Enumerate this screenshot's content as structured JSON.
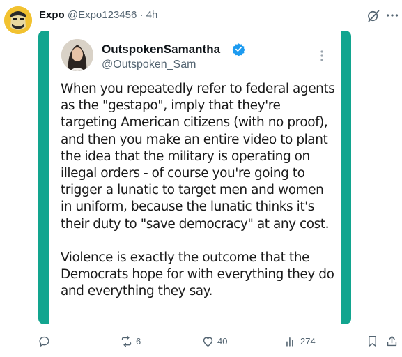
{
  "post": {
    "author_name": "Expo",
    "author_handle": "@Expo123456",
    "separator": "·",
    "time": "4h",
    "icons": {
      "avatar": "cartoon-face-avatar",
      "grok": "grok-icon",
      "more": "more-horizontal-icon"
    }
  },
  "screenshot_card": {
    "border_color": "#12a58f",
    "author_name": "OutspokenSamantha",
    "author_handle": "@Outspoken_Sam",
    "verified": true,
    "verified_color": "#1d9bf0",
    "paragraphs": [
      "When you repeatedly refer to federal agents as the \"gestapo\", imply that they're targeting American citizens (with no proof), and then you make an entire video to plant the idea that the military is operating on illegal orders - of course you're going to trigger a lunatic to target men and women in uniform, because the lunatic thinks it's their duty to \"save democracy\" at any cost.",
      "Violence is exactly the outcome that the Democrats hope for with everything they do and everything they say."
    ]
  },
  "actions": {
    "reply": {
      "icon": "reply-icon",
      "count": ""
    },
    "repost": {
      "icon": "repost-icon",
      "count": "6"
    },
    "like": {
      "icon": "heart-icon",
      "count": "40"
    },
    "views": {
      "icon": "views-icon",
      "count": "274"
    },
    "bookmark": {
      "icon": "bookmark-icon"
    },
    "share": {
      "icon": "share-icon"
    }
  }
}
